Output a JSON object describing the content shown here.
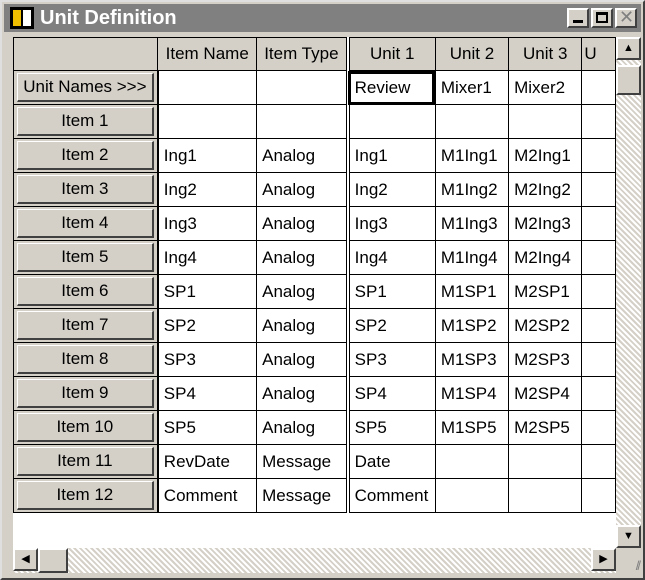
{
  "window": {
    "title": "Unit Definition"
  },
  "grid": {
    "headers": [
      "",
      "Item Name",
      "Item Type",
      "Unit 1",
      "Unit 2",
      "Unit 3",
      "U"
    ],
    "rows": [
      [
        "Unit Names >>>",
        "",
        "",
        "Review",
        "Mixer1",
        "Mixer2"
      ],
      [
        "Item 1",
        "",
        "",
        "",
        "",
        ""
      ],
      [
        "Item 2",
        "Ing1",
        "Analog",
        "Ing1",
        "M1Ing1",
        "M2Ing1"
      ],
      [
        "Item 3",
        "Ing2",
        "Analog",
        "Ing2",
        "M1Ing2",
        "M2Ing2"
      ],
      [
        "Item 4",
        "Ing3",
        "Analog",
        "Ing3",
        "M1Ing3",
        "M2Ing3"
      ],
      [
        "Item 5",
        "Ing4",
        "Analog",
        "Ing4",
        "M1Ing4",
        "M2Ing4"
      ],
      [
        "Item 6",
        "SP1",
        "Analog",
        "SP1",
        "M1SP1",
        "M2SP1"
      ],
      [
        "Item 7",
        "SP2",
        "Analog",
        "SP2",
        "M1SP2",
        "M2SP2"
      ],
      [
        "Item 8",
        "SP3",
        "Analog",
        "SP3",
        "M1SP3",
        "M2SP3"
      ],
      [
        "Item 9",
        "SP4",
        "Analog",
        "SP4",
        "M1SP4",
        "M2SP4"
      ],
      [
        "Item 10",
        "SP5",
        "Analog",
        "SP5",
        "M1SP5",
        "M2SP5"
      ],
      [
        "Item 11",
        "RevDate",
        "Message",
        "Date",
        "",
        ""
      ],
      [
        "Item 12",
        "Comment",
        "Message",
        "Comment",
        "",
        ""
      ]
    ]
  },
  "icons": {
    "app": "unit-definition-app-icon",
    "minimize": "minimize-icon",
    "maximize": "maximize-icon",
    "close": "close-icon",
    "scroll_up": "arrow-up-icon",
    "scroll_down": "arrow-down-icon",
    "scroll_left": "arrow-left-icon",
    "scroll_right": "arrow-right-icon"
  },
  "colors": {
    "titlebar": "#808080",
    "face": "#d4d0c8"
  }
}
